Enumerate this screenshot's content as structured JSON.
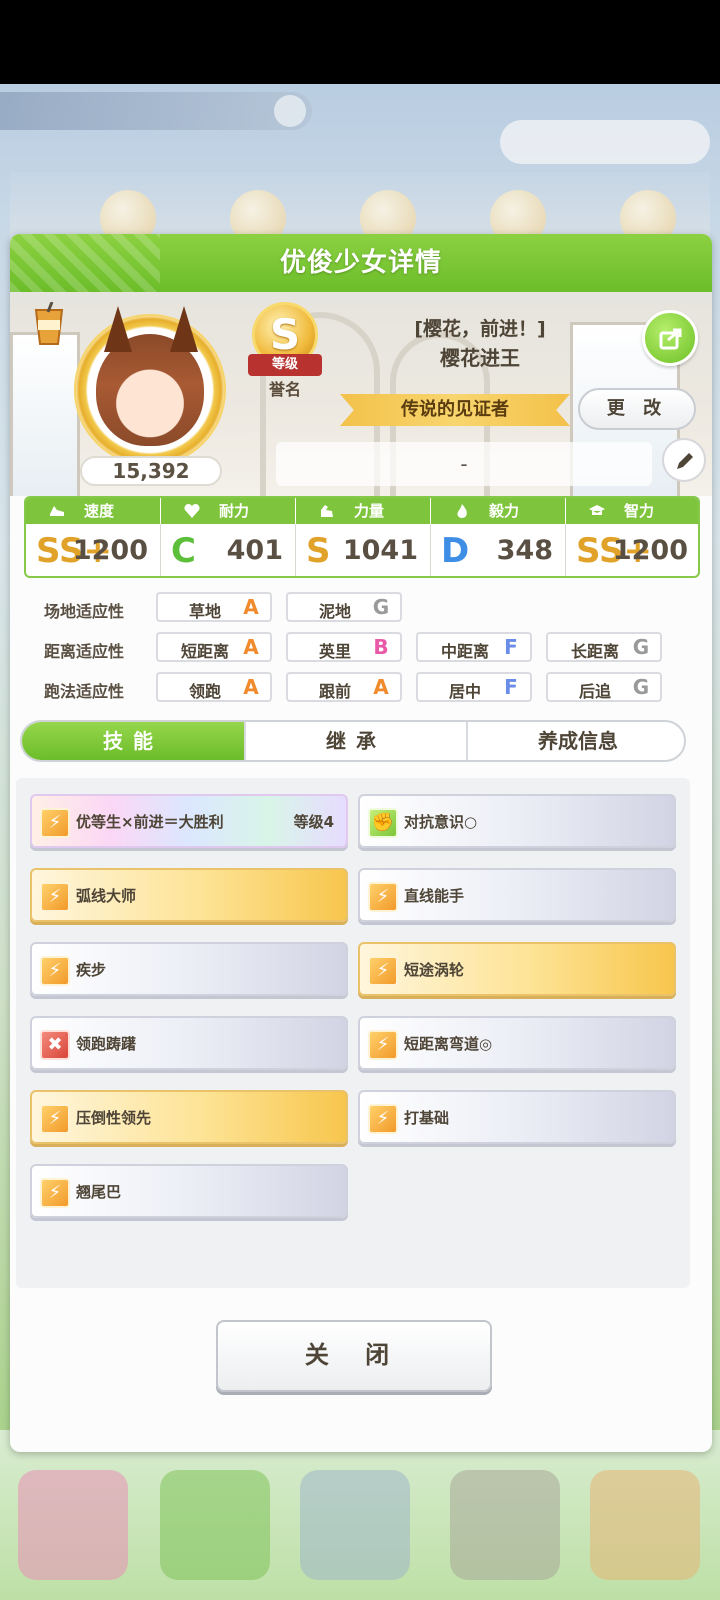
{
  "modal": {
    "title": "优俊少女详情"
  },
  "profile": {
    "fans": "15,392",
    "rank_letter": "S",
    "rank_ribbon": "等级",
    "rank_label": "誉名",
    "title_line1": "[樱花，前进！]",
    "title_line2": "樱花进王",
    "epithet": "传说的见证者",
    "change_label": "更 改",
    "comment": "-"
  },
  "stats": [
    {
      "label": "速度",
      "grade": "SS+",
      "value": "1200",
      "icon": "shoe-icon",
      "color": "#e0a228"
    },
    {
      "label": "耐力",
      "grade": "C",
      "value": "401",
      "icon": "heart-icon",
      "color": "#5cbf3a"
    },
    {
      "label": "力量",
      "grade": "S",
      "value": "1041",
      "icon": "muscle-icon",
      "color": "#e0a228"
    },
    {
      "label": "毅力",
      "grade": "D",
      "value": "348",
      "icon": "flame-icon",
      "color": "#3f8ee6"
    },
    {
      "label": "智力",
      "grade": "SS+",
      "value": "1200",
      "icon": "graduation-cap-icon",
      "color": "#e0a228"
    }
  ],
  "aptitude": {
    "track_label": "场地适应性",
    "distance_label": "距离适应性",
    "style_label": "跑法适应性",
    "track": [
      {
        "name": "草地",
        "grade": "A"
      },
      {
        "name": "泥地",
        "grade": "G"
      }
    ],
    "distance": [
      {
        "name": "短距离",
        "grade": "A"
      },
      {
        "name": "英里",
        "grade": "B"
      },
      {
        "name": "中距离",
        "grade": "F"
      },
      {
        "name": "长距离",
        "grade": "G"
      }
    ],
    "style": [
      {
        "name": "领跑",
        "grade": "A"
      },
      {
        "name": "跟前",
        "grade": "A"
      },
      {
        "name": "居中",
        "grade": "F"
      },
      {
        "name": "后追",
        "grade": "G"
      }
    ]
  },
  "grade_colors": {
    "A": "#f08a2c",
    "B": "#e85aa8",
    "F": "#6a8ee8",
    "G": "#9a9a9a"
  },
  "tabs": {
    "skill": "技能",
    "inherit": "继承",
    "info": "养成信息"
  },
  "skills": [
    {
      "name": "优等生×前进＝大胜利",
      "level": "等级4",
      "style": "rainbow",
      "icon": "skill-speed-icon"
    },
    {
      "name": "对抗意识○",
      "style": "silver",
      "icon": "skill-power-icon"
    },
    {
      "name": "弧线大师",
      "style": "gold",
      "icon": "skill-speed-icon"
    },
    {
      "name": "直线能手",
      "style": "silver",
      "icon": "skill-speed-icon"
    },
    {
      "name": "疾步",
      "style": "silver",
      "icon": "skill-speed-icon"
    },
    {
      "name": "短途涡轮",
      "style": "gold",
      "icon": "skill-speed-icon"
    },
    {
      "name": "领跑踌躇",
      "style": "silver",
      "icon": "skill-debuff-icon"
    },
    {
      "name": "短距离弯道◎",
      "style": "silver",
      "icon": "skill-speed-icon"
    },
    {
      "name": "压倒性领先",
      "style": "gold",
      "icon": "skill-speed-icon"
    },
    {
      "name": "打基础",
      "style": "silver",
      "icon": "skill-speed-icon"
    },
    {
      "name": "翘尾巴",
      "style": "silver",
      "icon": "skill-speed-icon"
    }
  ],
  "close_label": "关 闭"
}
